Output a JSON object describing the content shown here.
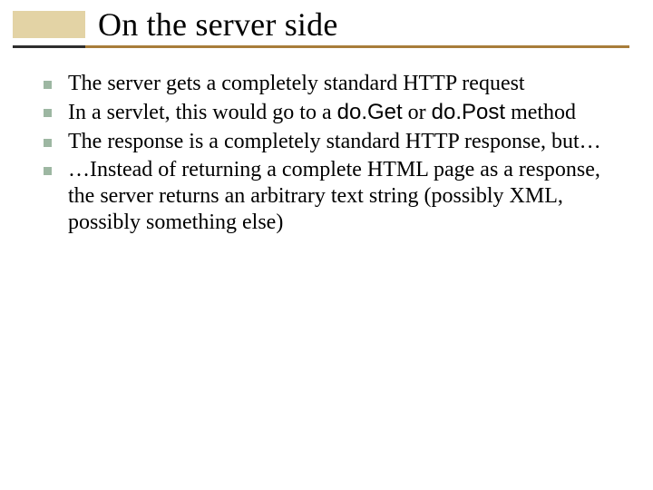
{
  "title": "On the server side",
  "bullets": [
    {
      "pre": "The server gets a completely standard HTTP request"
    },
    {
      "pre": "In a servlet, this would go to a ",
      "code1": "do.Get",
      "mid": " or ",
      "code2": "do.Post",
      "post": " method"
    },
    {
      "pre": "The response is a completely standard HTTP response, but…"
    },
    {
      "pre": "…Instead of returning a complete HTML page as a response, the server returns an arbitrary text string (possibly XML, possibly something else)"
    }
  ]
}
